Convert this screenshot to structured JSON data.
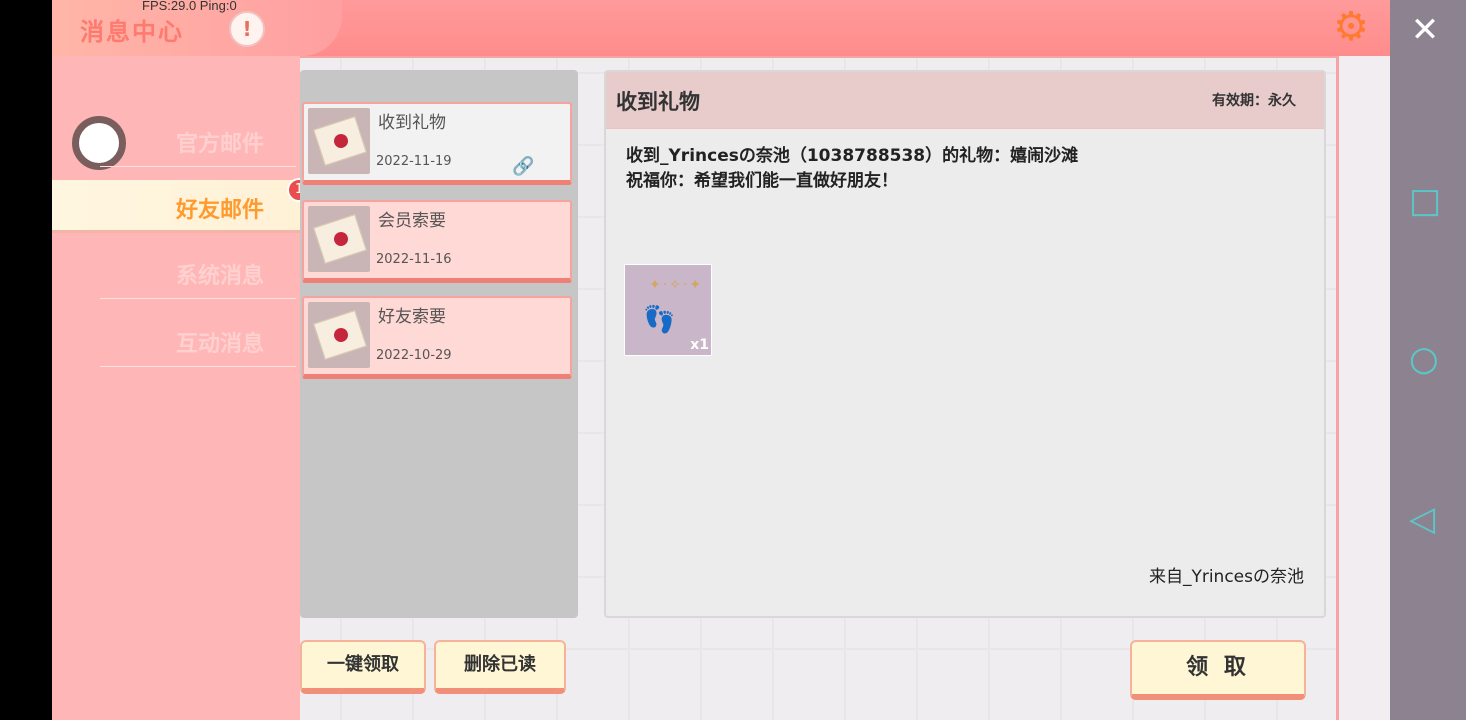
{
  "header": {
    "title": "消息中心",
    "fps_text": "FPS:29.0  Ping:0",
    "warn_icon": "exclamation-icon",
    "settings_icon": "gear-icon",
    "close_icon": "close-icon"
  },
  "sidebar": {
    "items": [
      {
        "label": "官方邮件",
        "active": false
      },
      {
        "label": "好友邮件",
        "active": true,
        "badge": "1"
      },
      {
        "label": "系统消息",
        "active": false
      },
      {
        "label": "互动消息",
        "active": false
      }
    ]
  },
  "mail_list": [
    {
      "title": "收到礼物",
      "date": "2022-11-19",
      "read": true,
      "attachment": true
    },
    {
      "title": "会员索要",
      "date": "2022-11-16",
      "read": false
    },
    {
      "title": "好友索要",
      "date": "2022-10-29",
      "read": false
    }
  ],
  "actions": {
    "claim_all": "一键领取",
    "delete_read": "删除已读",
    "claim": "领 取"
  },
  "detail": {
    "title": "收到礼物",
    "validity": "有效期：永久",
    "body_line1": "收到_Yrincesの奈池（1038788538）的礼物：嬉闹沙滩",
    "body_line2": "祝福你：希望我们能一直做好朋友！",
    "item_qty": "x1",
    "from": "来自_Yrincesの奈池"
  },
  "colors": {
    "topbar": "#ff8c8c",
    "sidebar": "#ffb6b6",
    "active_label": "#ff9a2e",
    "button_bg": "#fff6d6"
  }
}
